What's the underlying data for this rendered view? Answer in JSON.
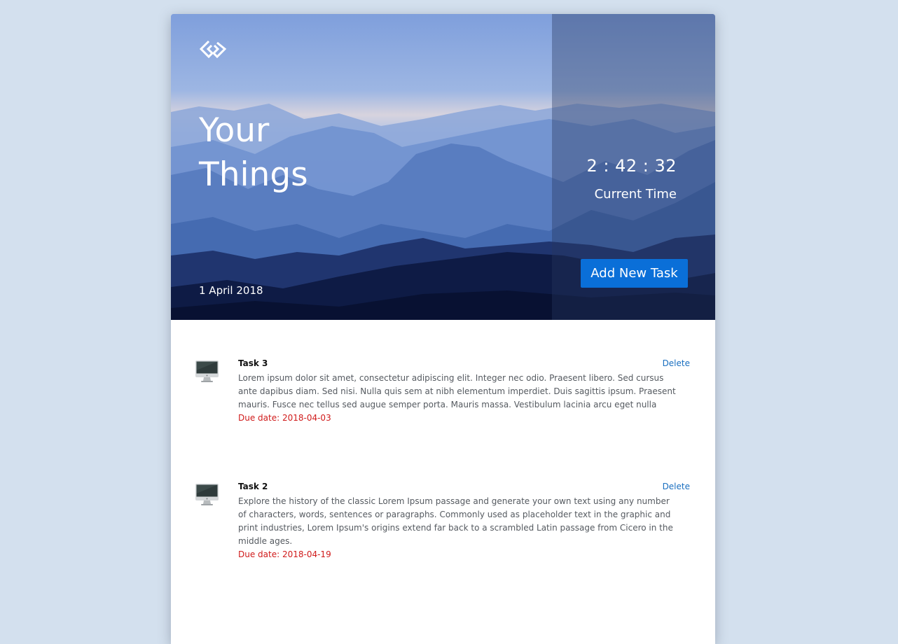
{
  "hero": {
    "title_line1": "Your",
    "title_line2": "Things",
    "date": "1 April 2018",
    "time": "2 : 42 : 32",
    "time_label": "Current Time",
    "add_button_label": "Add New Task"
  },
  "tasks": [
    {
      "title": "Task 3",
      "description": "Lorem ipsum dolor sit amet, consectetur adipiscing elit. Integer nec odio. Praesent libero. Sed cursus ante dapibus diam. Sed nisi. Nulla quis sem at nibh elementum imperdiet. Duis sagittis ipsum. Praesent mauris. Fusce nec tellus sed augue semper porta. Mauris massa. Vestibulum lacinia arcu eget nulla",
      "due": "Due date: 2018-04-03",
      "delete_label": "Delete",
      "icon": "monitor-icon"
    },
    {
      "title": "Task 2",
      "description": "Explore the history of the classic Lorem Ipsum passage and generate your own text using any number of characters, words, sentences or paragraphs. Commonly used as placeholder text in the graphic and print industries, Lorem Ipsum's origins extend far back to a scrambled Latin passage from Cicero in the middle ages.",
      "due": "Due date: 2018-04-19",
      "delete_label": "Delete",
      "icon": "monitor-icon"
    }
  ],
  "colors": {
    "background": "#d3e0ee",
    "accent": "#0a6fd8",
    "delete_link": "#1a6fc0",
    "due_date": "#d01a1a"
  }
}
